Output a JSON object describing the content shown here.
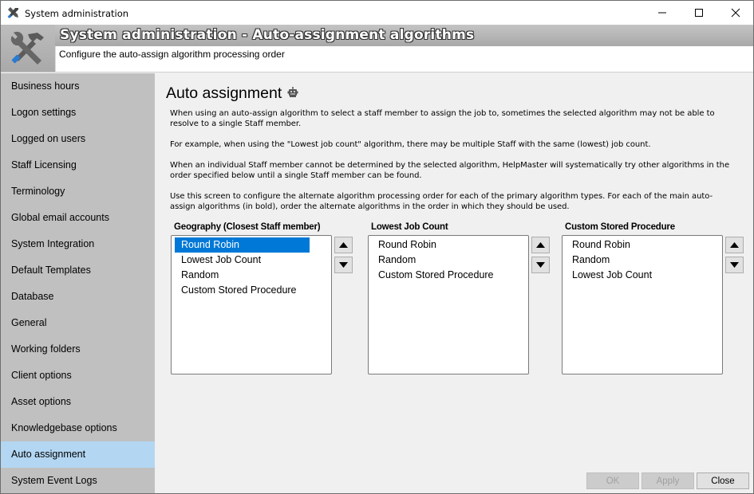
{
  "window": {
    "title": "System administration",
    "icons": {
      "app": "tools-icon",
      "minimize": "minimize-icon",
      "maximize": "maximize-icon",
      "close": "close-icon"
    }
  },
  "banner": {
    "title": "System administration - Auto-assignment algorithms",
    "subtitle": "Configure the auto-assign algorithm processing order",
    "icon": "wrench-hammer-icon"
  },
  "sidebar": {
    "items": [
      {
        "label": "Business hours",
        "active": false
      },
      {
        "label": "Logon settings",
        "active": false
      },
      {
        "label": "Logged on users",
        "active": false
      },
      {
        "label": "Staff Licensing",
        "active": false
      },
      {
        "label": "Terminology",
        "active": false
      },
      {
        "label": "Global email accounts",
        "active": false
      },
      {
        "label": "System Integration",
        "active": false
      },
      {
        "label": "Default Templates",
        "active": false
      },
      {
        "label": "Database",
        "active": false
      },
      {
        "label": "General",
        "active": false
      },
      {
        "label": "Working folders",
        "active": false
      },
      {
        "label": "Client options",
        "active": false
      },
      {
        "label": "Asset options",
        "active": false
      },
      {
        "label": "Knowledgebase options",
        "active": false
      },
      {
        "label": "Auto assignment",
        "active": true
      },
      {
        "label": "System Event Logs",
        "active": false
      }
    ],
    "active_color": "#b3d7f3"
  },
  "main": {
    "heading": "Auto assignment",
    "heading_icon": "robot-icon",
    "paragraphs": [
      "When using an auto-assign algorithm to select a staff member to assign the job to, sometimes the selected algorithm may not be able to resolve to a single Staff member.",
      "For example, when using the \"Lowest job count\" algorithm, there may be multiple Staff with the same (lowest) job count.",
      "When an individual Staff member cannot be determined by the selected algorithm, HelpMaster will systematically try other algorithms in the order specified below until a single Staff member can be found.",
      "Use this screen to configure the alternate algorithm processing order for each of the primary algorithm types.  For each of the main auto-assign algorithms (in bold), order the alternate algorithms in the order in which they should be used."
    ],
    "groups": [
      {
        "label": "Geography (Closest Staff member)",
        "items": [
          "Round Robin",
          "Lowest Job Count",
          "Random",
          "Custom Stored Procedure"
        ],
        "selected_index": 0
      },
      {
        "label": "Lowest Job Count",
        "items": [
          "Round Robin",
          "Random",
          "Custom Stored Procedure"
        ],
        "selected_index": -1
      },
      {
        "label": "Custom Stored Procedure",
        "items": [
          "Round Robin",
          "Random",
          "Lowest Job Count"
        ],
        "selected_index": -1
      }
    ],
    "move_up_icon": "triangle-up-icon",
    "move_down_icon": "triangle-down-icon",
    "selection_color": "#0078d7"
  },
  "footer": {
    "ok_label": "OK",
    "ok_enabled": false,
    "apply_label": "Apply",
    "apply_enabled": false,
    "close_label": "Close",
    "close_enabled": true
  }
}
